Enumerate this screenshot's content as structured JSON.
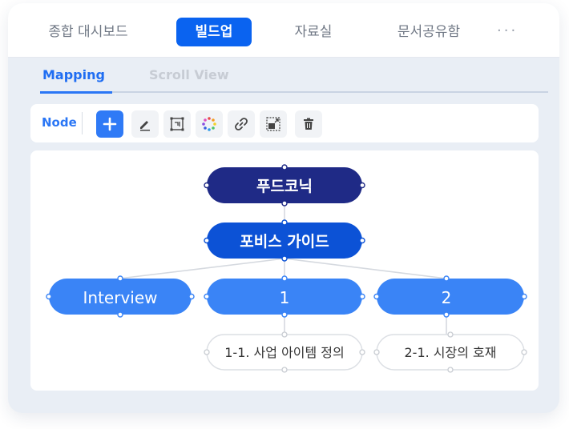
{
  "nav": {
    "tabs": [
      {
        "label": "종합 대시보드",
        "active": false
      },
      {
        "label": "빌드업",
        "active": true
      },
      {
        "label": "자료실",
        "active": false
      },
      {
        "label": "문서공유함",
        "active": false
      }
    ],
    "more_label": "···"
  },
  "subtabs": [
    {
      "label": "Mapping",
      "active": true
    },
    {
      "label": "Scroll View",
      "active": false
    }
  ],
  "toolbar": {
    "node_label": "Node",
    "tools": [
      "add-icon",
      "edit-pen-icon",
      "text-box-icon",
      "color-palette-icon",
      "link-icon",
      "image-icon",
      "trash-icon"
    ]
  },
  "mindmap": {
    "root": "푸드코닉",
    "level1": "포비스 가이드",
    "level2": [
      "Interview",
      "1",
      "2"
    ],
    "level3": [
      "1-1. 사업 아이템 정의",
      "2-1. 시장의 호재"
    ]
  },
  "colors": {
    "root": "#1f2a86",
    "level1": "#0c52d6",
    "level2": "#3a84f6",
    "accent": "#0a63f0"
  }
}
